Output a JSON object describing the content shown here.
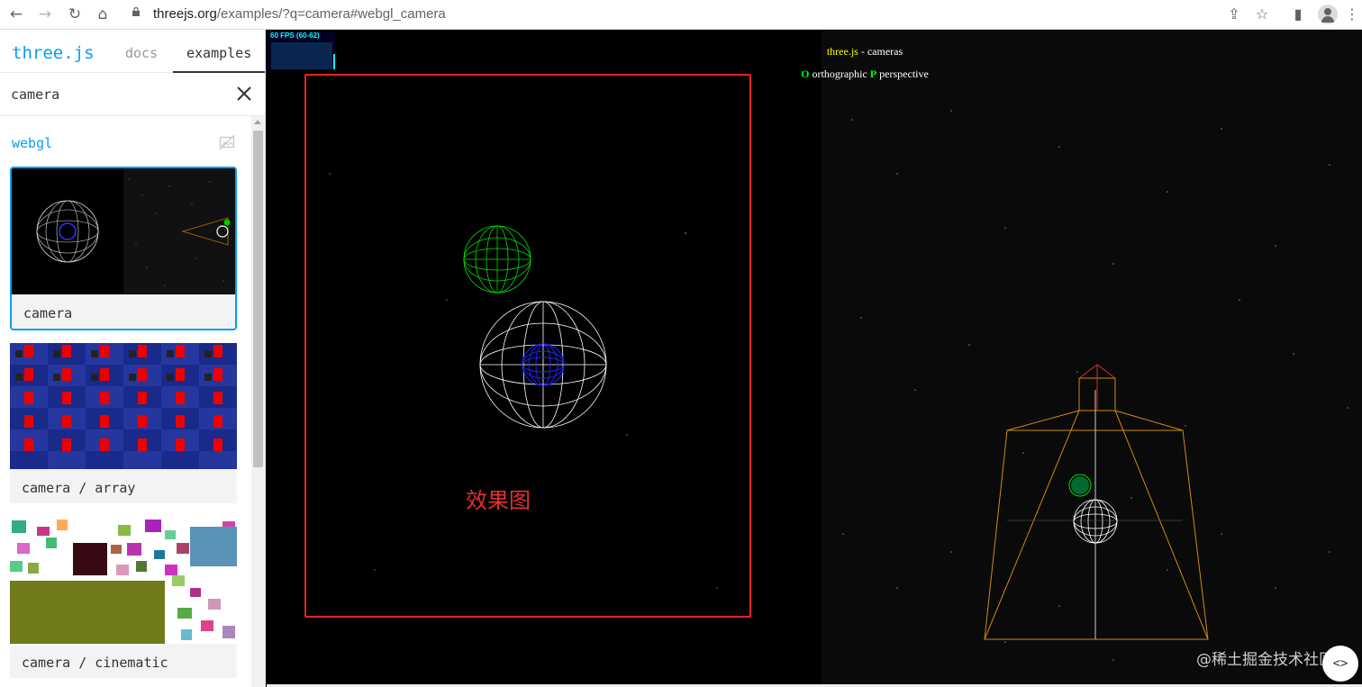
{
  "browser": {
    "back_icon": "arrow-left-icon",
    "forward_icon": "arrow-right-icon",
    "reload_icon": "reload-icon",
    "home_icon": "home-icon",
    "url_host": "threejs.org",
    "url_path": "/examples/?q=camera#webgl_camera"
  },
  "sidebar": {
    "brand": "three.js",
    "tabs": {
      "docs": "docs",
      "examples": "examples"
    },
    "search_value": "camera",
    "category": "webgl",
    "items": [
      {
        "label": "camera",
        "selected": true
      },
      {
        "label": "camera / array",
        "selected": false
      },
      {
        "label": "camera / cinematic",
        "selected": false
      }
    ]
  },
  "viewport": {
    "stats": "60 FPS (60-62)",
    "info_title": "three.js",
    "info_title_rest": " - cameras",
    "key_o": "O",
    "mode_o": " orthographic ",
    "key_p": "P",
    "mode_p": " perspective",
    "annotation": "效果图",
    "watermark": "@稀土掘金技术社区",
    "source_button": "<>"
  },
  "colors": {
    "accent": "#049ef4",
    "annotation": "#e52222",
    "sphere_green": "#00ff00",
    "sphere_blue": "#0000ff",
    "frustum": "#ffaa00"
  }
}
